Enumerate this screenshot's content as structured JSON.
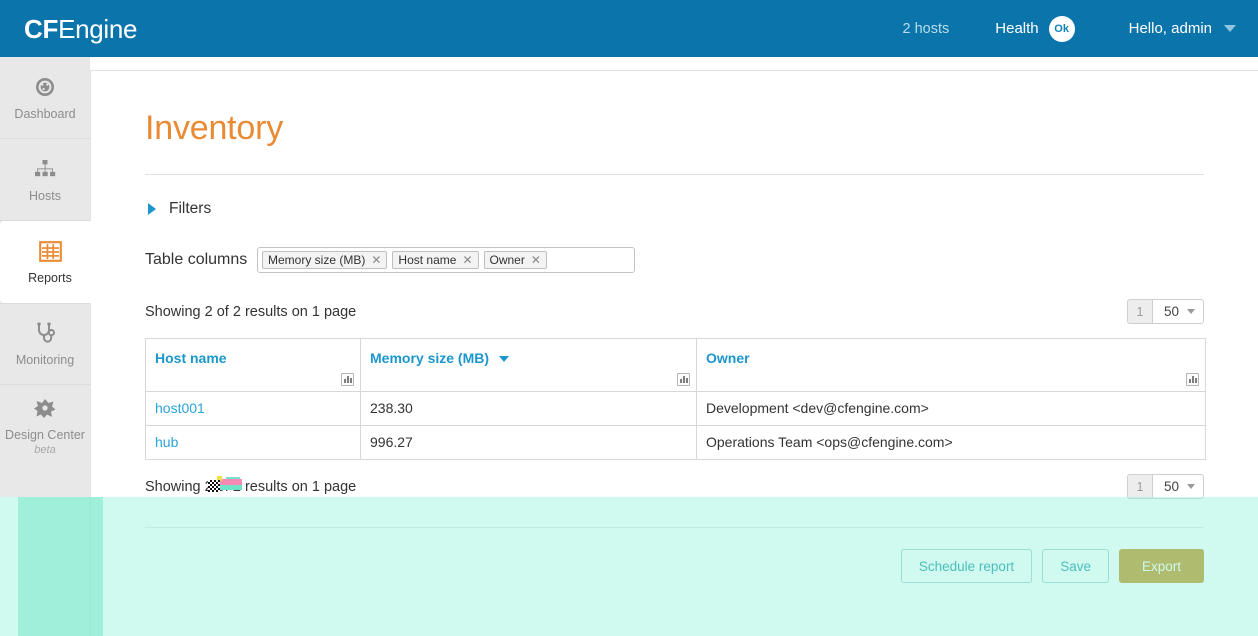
{
  "topbar": {
    "brand_bold": "CF",
    "brand_rest": "Engine",
    "hosts_count": "2 hosts",
    "health_label": "Health",
    "health_status": "Ok",
    "user_greeting": "Hello, admin",
    "caret_icon": "chevron-down-icon",
    "brand_bg": "#0b75ab"
  },
  "sidebar": {
    "items": [
      {
        "label": "Dashboard",
        "icon": "dashboard-gauge-icon",
        "active": false
      },
      {
        "label": "Hosts",
        "icon": "hosts-hierarchy-icon",
        "active": false
      },
      {
        "label": "Reports",
        "icon": "reports-grid-icon",
        "active": true
      },
      {
        "label": "Monitoring",
        "icon": "stethoscope-icon",
        "active": false
      },
      {
        "label": "Design Center",
        "sub": "beta",
        "icon": "design-center-icon",
        "active": false
      }
    ],
    "active_accent": "#e98b35"
  },
  "page": {
    "title": "Inventory",
    "title_color": "#e98b35",
    "filters_label": "Filters",
    "filters_chevron": "chevron-right-icon"
  },
  "table_columns": {
    "label": "Table columns",
    "tags": [
      {
        "label": "Memory size (MB)",
        "remove_icon": "close-icon"
      },
      {
        "label": "Host name",
        "remove_icon": "close-icon"
      },
      {
        "label": "Owner",
        "remove_icon": "close-icon"
      }
    ],
    "input_placeholder": ""
  },
  "results": {
    "summary_top": "Showing 2 of 2 results on 1 page",
    "summary_bottom": "Showing 2 of 2 results on 1 page",
    "page_number": "1",
    "page_size": "50"
  },
  "table": {
    "columns": [
      {
        "label": "Host name",
        "sorted": false,
        "chart_icon": "bar-chart-icon"
      },
      {
        "label": "Memory size (MB)",
        "sorted": true,
        "sort_icon": "chevron-down-icon",
        "chart_icon": "bar-chart-icon"
      },
      {
        "label": "Owner",
        "sorted": false,
        "chart_icon": "bar-chart-icon"
      }
    ],
    "rows": [
      {
        "host": "host001",
        "memory": "238.30",
        "owner": "Development <dev@cfengine.com>"
      },
      {
        "host": "hub",
        "memory": "996.27",
        "owner": "Operations Team <ops@cfengine.com>"
      }
    ]
  },
  "actions": {
    "schedule_label": "Schedule report",
    "save_label": "Save",
    "export_label": "Export",
    "export_color": "#c79420"
  }
}
